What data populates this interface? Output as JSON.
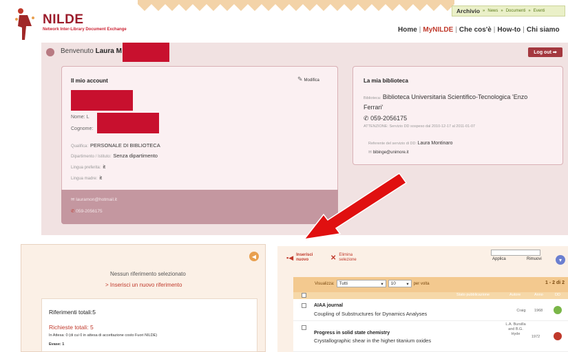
{
  "header": {
    "logo_title": "NILDE",
    "logo_subtitle": "Network Inter-Library Document Exchange",
    "topnav": {
      "main": "Archivio",
      "items": [
        "News",
        "Documenti",
        "Eventi"
      ],
      "separator": "»"
    },
    "mainnav": [
      "Home",
      "MyNILDE",
      "Che cos'è",
      "How-to",
      "Chi siamo"
    ],
    "mainnav_active": "MyNILDE",
    "mainnav_sep": "|"
  },
  "welcome": {
    "prefix": "Benvenuto",
    "name": "Laura M"
  },
  "logout_label": "Log out ➡",
  "account": {
    "title": "Il mio account",
    "edit_label": "Modifica",
    "nome_label": "Nome:",
    "nome_value": "L",
    "cognome_label": "Cognome:",
    "qualifica_label": "Qualifica:",
    "qualifica_value": "PERSONALE DI BIBLIOTECA",
    "dipartimento_label": "Dipartimento / Istituto:",
    "dipartimento_value": "Senza dipartimento",
    "lingua_pref_label": "Lingua preferita:",
    "lingua_pref_value": "it",
    "lingua_madre_label": "Lingua madre:",
    "lingua_madre_value": "it",
    "email": "lauramon@hotmail.it",
    "phone": "059-2056175"
  },
  "library": {
    "title": "La mia biblioteca",
    "biblioteca_label": "Biblioteca:",
    "biblioteca_line1": "Biblioteca Universitaria Scientifico-Tecnologica 'Enzo",
    "biblioteca_line2": "Ferrari'",
    "phone": "059-2056175",
    "attention": "ATTENZIONE: Servizio DD sospeso dal 2010-12-17 al 2011-01-07",
    "referente_label": "Referente del servizio di DD:",
    "referente_value": "Laura Montinaro",
    "email": "bibinge@unimore.it"
  },
  "left_panel": {
    "none_selected": "Nessun riferimento selezionato",
    "insert_link": "> Inserisci un nuovo riferimento",
    "totals": "Riferimenti totali:5",
    "requests": "Richieste totali: 5",
    "waiting": "In Attesa: 0 (di cui 0 in attesa di accettazione costo Fuori NILDE)",
    "evase": "Evase: 1"
  },
  "right_panel": {
    "insert_new_line1": "Inserisci",
    "insert_new_line2": "nuovo",
    "delete_line1": "Elimina",
    "delete_line2": "selezione",
    "apply": "Applica",
    "remove": "Rimuovi",
    "view_label": "Visualizza:",
    "view_value": "Tutti",
    "per_page_value": "10",
    "per_page_suffix": "per volta",
    "page_count": "1 - 2 di 2",
    "columns": [
      "Stato pubblicazione",
      "Autore",
      "Anno",
      "DD"
    ],
    "rows": [
      {
        "journal": "AIAA journal",
        "title": "Coupling of Substructures for Dynamics Analyses",
        "author": "Craig",
        "year": "1968",
        "status_color": "#7ab648"
      },
      {
        "journal": "Progress in solid state chemistry",
        "title": "Crystallographic shear in the higher titanium oxides",
        "author": "L.A. Bursilla and B.G. Hyde",
        "year": "1972",
        "status_color": "#c0392b"
      }
    ]
  },
  "colors": {
    "brand": "#9b1b2a",
    "accent": "#c0392b",
    "arrow": "#e01010"
  }
}
